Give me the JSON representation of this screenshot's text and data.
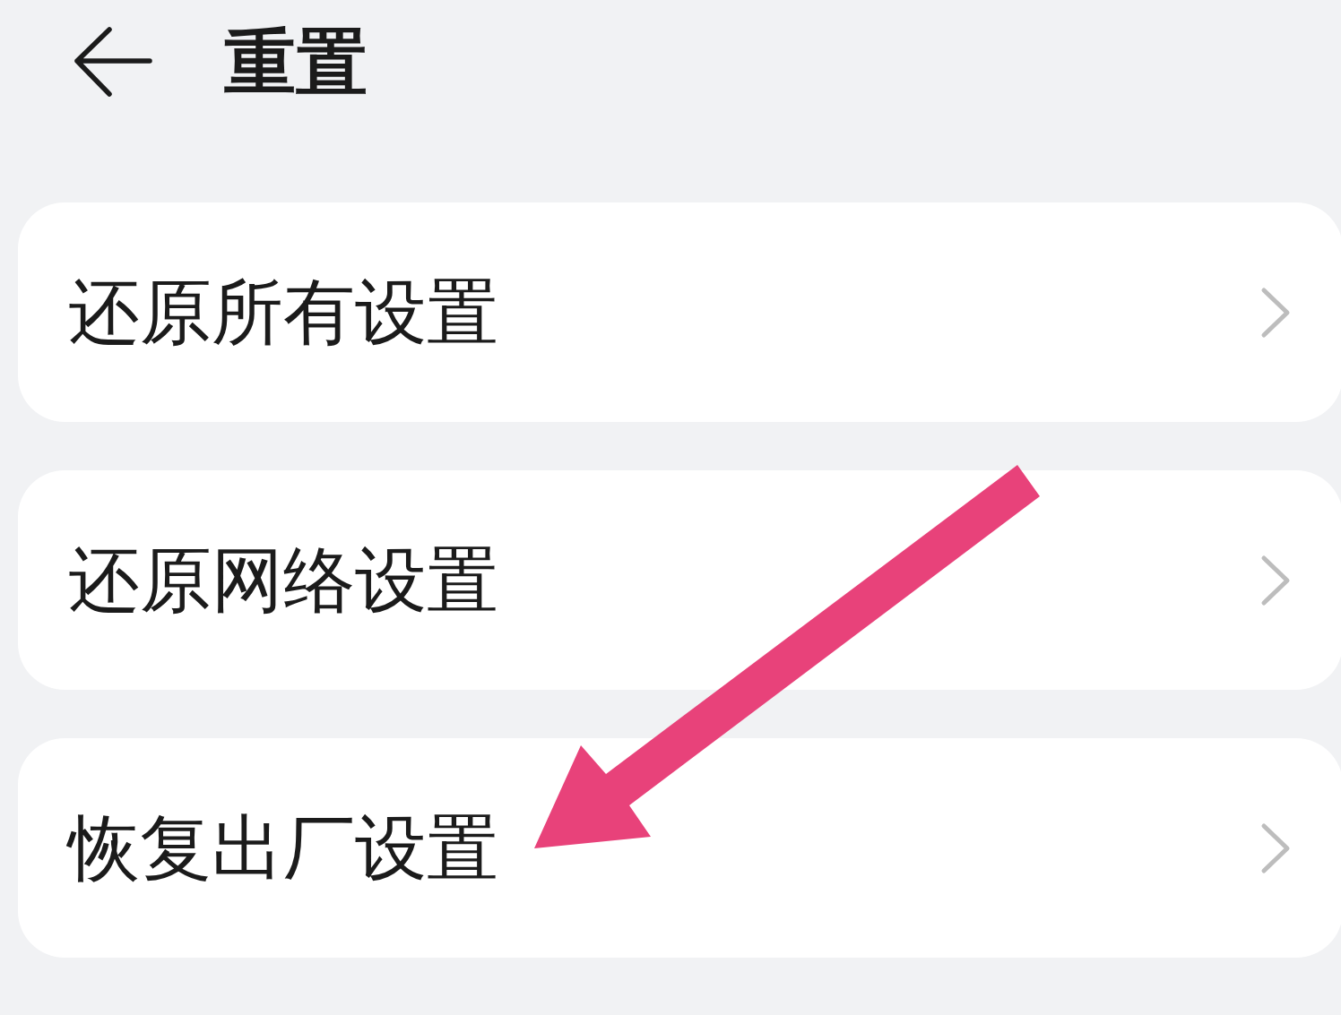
{
  "header": {
    "title": "重置"
  },
  "items": [
    {
      "label": "还原所有设置",
      "annotated": false
    },
    {
      "label": "还原网络设置",
      "annotated": false
    },
    {
      "label": "恢复出厂设置",
      "annotated": true
    }
  ]
}
